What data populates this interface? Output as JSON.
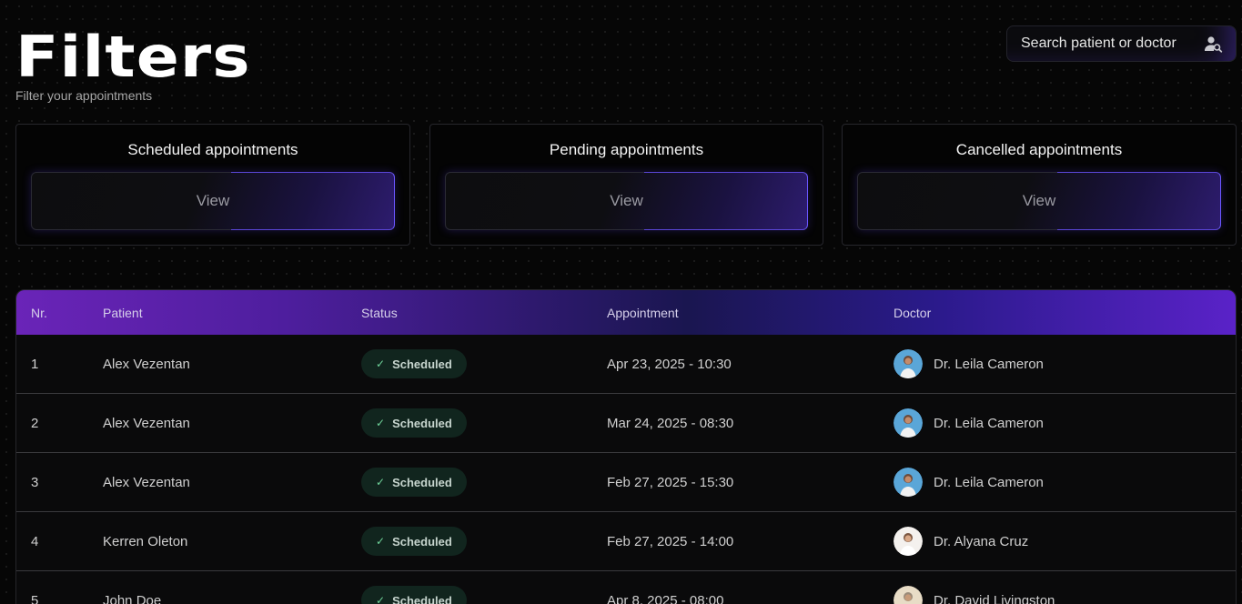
{
  "header": {
    "title": "Filters",
    "subtitle": "Filter your appointments"
  },
  "search": {
    "placeholder": "Search patient or doctor",
    "icon": "user-search-icon"
  },
  "cards": [
    {
      "title": "Scheduled appointments",
      "button": "View"
    },
    {
      "title": "Pending appointments",
      "button": "View"
    },
    {
      "title": "Cancelled appointments",
      "button": "View"
    }
  ],
  "table": {
    "columns": [
      "Nr.",
      "Patient",
      "Status",
      "Appointment",
      "Doctor"
    ],
    "rows": [
      {
        "nr": "1",
        "patient": "Alex Vezentan",
        "status": "Scheduled",
        "appointment": "Apr 23, 2025 - 10:30",
        "doctor": "Dr. Leila Cameron",
        "avatar": "blue"
      },
      {
        "nr": "2",
        "patient": "Alex Vezentan",
        "status": "Scheduled",
        "appointment": "Mar 24, 2025 - 08:30",
        "doctor": "Dr. Leila Cameron",
        "avatar": "blue"
      },
      {
        "nr": "3",
        "patient": "Alex Vezentan",
        "status": "Scheduled",
        "appointment": "Feb 27, 2025 - 15:30",
        "doctor": "Dr. Leila Cameron",
        "avatar": "blue"
      },
      {
        "nr": "4",
        "patient": "Kerren Oleton",
        "status": "Scheduled",
        "appointment": "Feb 27, 2025 - 14:00",
        "doctor": "Dr. Alyana Cruz",
        "avatar": "light"
      },
      {
        "nr": "5",
        "patient": "John Doe",
        "status": "Scheduled",
        "appointment": "Apr 8, 2025 - 08:00",
        "doctor": "Dr. David Livingston",
        "avatar": "beige"
      }
    ]
  },
  "colors": {
    "accent_purple": "#6a24b8",
    "accent_blue": "#2a1a8a",
    "status_green": "#11251e",
    "check_green": "#6fd39a"
  }
}
